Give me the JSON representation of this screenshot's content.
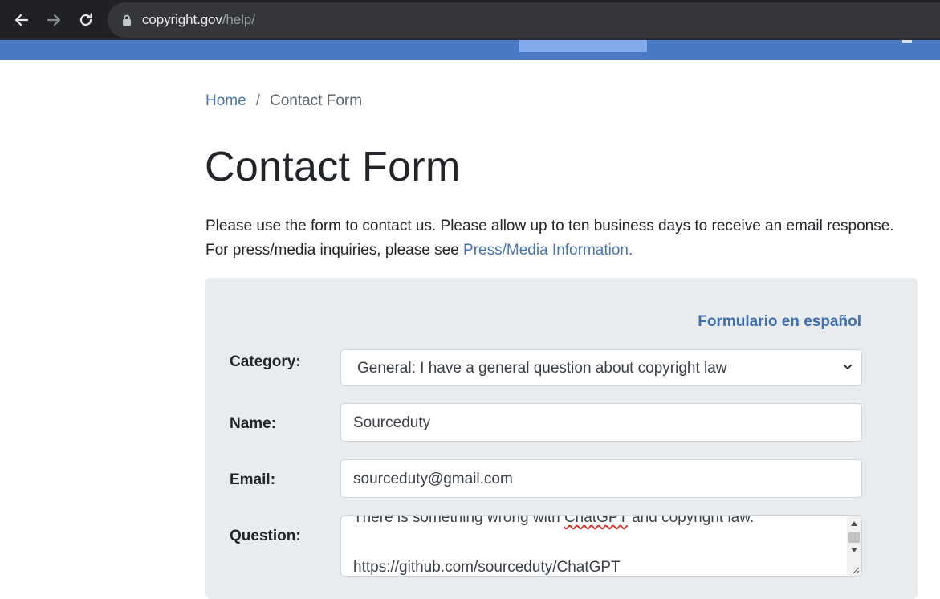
{
  "browser": {
    "url_host": "copyright.gov",
    "url_path": "/help/"
  },
  "breadcrumb": {
    "home": "Home",
    "separator": "/",
    "current": "Contact Form"
  },
  "page": {
    "title": "Contact Form",
    "intro_line1": "Please use the form to contact us. Please allow up to ten business days to receive an email response.",
    "intro_line2_prefix": "For press/media inquiries, please see ",
    "intro_link": "Press/Media Information."
  },
  "form": {
    "spanish_link": "Formulario en español",
    "category_label": "Category:",
    "category_value": "General: I have a general question about copyright law",
    "name_label": "Name:",
    "name_value": "Sourceduty",
    "email_label": "Email:",
    "email_value": "sourceduty@gmail.com",
    "question_label": "Question:",
    "question_line1_a": "There is something wrong with ",
    "question_line1_misspelled": "ChatGPT",
    "question_line1_b": " and copyright law.",
    "question_line2": "https://github.com/sourceduty/ChatGPT"
  },
  "colors": {
    "site_bar": "#4a78c2",
    "link": "#4a73b4",
    "panel": "#e9ecef"
  }
}
